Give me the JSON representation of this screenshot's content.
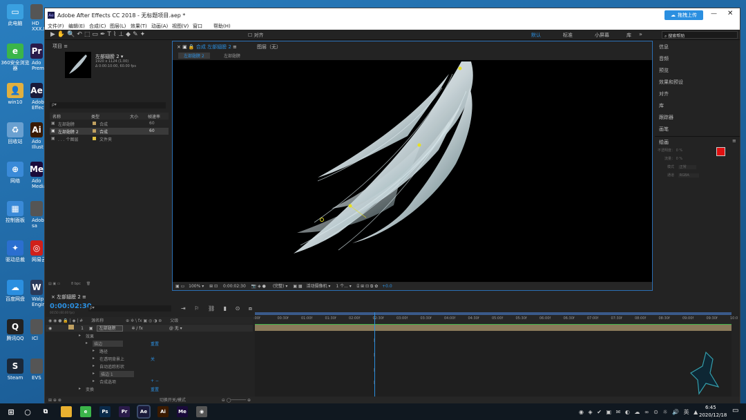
{
  "desktop": {
    "icons": [
      {
        "label": "此电脑",
        "glyph": "▭",
        "color": "#3aa0e0"
      },
      {
        "label": "360安全浏览器",
        "glyph": "e",
        "color": "#3bb54a"
      },
      {
        "label": "win10",
        "glyph": "👤",
        "color": "#e0b040"
      },
      {
        "label": "回收站",
        "glyph": "♻",
        "color": "#6aa0d0"
      },
      {
        "label": "网络",
        "glyph": "⊕",
        "color": "#3a8ad8"
      },
      {
        "label": "控制面板",
        "glyph": "▦",
        "color": "#3a8ad8"
      },
      {
        "label": "驱动总裁",
        "glyph": "✦",
        "color": "#2b6fd0"
      },
      {
        "label": "百度网盘",
        "glyph": "☁",
        "color": "#2b8fe0"
      },
      {
        "label": "腾讯QQ",
        "glyph": "Q",
        "color": "#222"
      },
      {
        "label": "Steam",
        "glyph": "S",
        "color": "#1b2838"
      }
    ],
    "icons2": [
      {
        "label": "HD\nXXX.E",
        "glyph": "",
        "color": "#555"
      },
      {
        "label": "Ado\nPremi",
        "glyph": "Pr",
        "color": "#2a1b4a"
      },
      {
        "label": "Adobe\nEffects",
        "glyph": "Ae",
        "color": "#1a1a3a"
      },
      {
        "label": "Ado\nIllust",
        "glyph": "Ai",
        "color": "#3a1a00"
      },
      {
        "label": "Ado\nMedia",
        "glyph": "Me",
        "color": "#1a0a3a"
      },
      {
        "label": "Adobe\nsa",
        "glyph": "",
        "color": "#555"
      },
      {
        "label": "网易云",
        "glyph": "◎",
        "color": "#d0201a"
      },
      {
        "label": "Walp\nEngin",
        "glyph": "W",
        "color": "#2a3a5a"
      },
      {
        "label": "ICl",
        "glyph": "",
        "color": "#555"
      },
      {
        "label": "EVS",
        "glyph": "",
        "color": "#555"
      }
    ]
  },
  "window": {
    "title": "Adobe After Effects CC 2018 - 无标题项目.aep *",
    "app_badge": "Ae",
    "upload_label": "拖拽上传",
    "menu": [
      "文件(F)",
      "编辑(E)",
      "合成(C)",
      "图层(L)",
      "效果(T)",
      "动画(A)",
      "视图(V)",
      "窗口",
      "帮助(H)"
    ],
    "toolbar_align_label": "对齐",
    "workspaces": [
      "默认",
      "标准",
      "小屏幕",
      "库"
    ],
    "search_placeholder": "搜索帮助"
  },
  "project": {
    "tab_label": "项目",
    "comp_name": "左部翅膀 2 ▾",
    "comp_info1": "1920 x 1124 (1.00)",
    "comp_info2": "Δ 0:00:10:00, 60.00 fps",
    "search_placeholder": "ρ▾",
    "columns": [
      "名称",
      "类型",
      "大小",
      "帧速率"
    ],
    "items": [
      {
        "name": "左部翅膀",
        "type": "合成",
        "size": "",
        "fps": "60",
        "color": "#c0a060"
      },
      {
        "name": "左部翅膀 2",
        "type": "合成",
        "size": "",
        "fps": "60",
        "color": "#c0a060"
      },
      {
        "name": ". . . 个图层",
        "type": "文件夹",
        "size": "",
        "fps": "",
        "color": "#e0c040"
      }
    ],
    "bpc": "8 bpc"
  },
  "composition": {
    "tab_label": "合成 左部翅膀 2",
    "layer_tab": "图层（无）",
    "subtab_active": "左部翅膀 2",
    "subtab_other": "左部翅膀",
    "zoom": "100%",
    "time": "0:00:02:30",
    "quality": "(完整)",
    "camera": "活动摄像机",
    "views": "1 个...",
    "exposure": "+0.0"
  },
  "right_panels": [
    "信息",
    "音频",
    "预览",
    "效果和预设",
    "对齐",
    "库",
    "跟踪器",
    "画笔"
  ],
  "paint": {
    "title": "绘画",
    "opacity_label": "不透明度：",
    "opacity_value": "0 %",
    "flow_label": "流量：",
    "flow_value": "0 %",
    "mode_label": "模式",
    "mode_value": "正常",
    "channel_label": "通道",
    "channel_value": "RGBA",
    "fg_color": "#e01010",
    "bg_color": "#ffffff"
  },
  "timeline": {
    "tab_label": "左部翅膀 2",
    "timecode": "0:00:02:30",
    "timecode_sub": "00150 (60.00 fps)",
    "search_placeholder": "ρ▾",
    "col_layer_name": "源名称",
    "col_parent": "父级",
    "ruler": [
      ":00f",
      "00:30f",
      "01:00f",
      "01:30f",
      "02:00f",
      "02:30f",
      "03:00f",
      "03:30f",
      "04:00f",
      "04:30f",
      "05:00f",
      "05:30f",
      "06:00f",
      "06:30f",
      "07:00f",
      "07:30f",
      "08:00f",
      "08:30f",
      "09:00f",
      "09:30f",
      "10:0"
    ],
    "current_time_fraction": 0.25,
    "layer": {
      "index": "1",
      "name": "左部翅膀",
      "parent": "无"
    },
    "rows": [
      {
        "indent": 1,
        "label": "效果",
        "value": ""
      },
      {
        "indent": 2,
        "label": "描边",
        "value": "重置"
      },
      {
        "indent": 3,
        "label": "路径",
        "value": ""
      },
      {
        "indent": 3,
        "label": "在透明背景上",
        "value": "关"
      },
      {
        "indent": 3,
        "label": "自动追踪形状",
        "value": ""
      },
      {
        "indent": 3,
        "label": "描边 1",
        "value": ""
      },
      {
        "indent": 3,
        "label": "合成选项",
        "value": "+ −"
      },
      {
        "indent": 1,
        "label": "变换",
        "value": "重置"
      }
    ],
    "footer_toggle": "切换开关/模式"
  },
  "taskbar": {
    "clock_time": "6:45",
    "clock_date": "2020/12/18",
    "ime": "英",
    "apps": [
      {
        "name": "file-explorer",
        "label": "",
        "color": "#e8b030"
      },
      {
        "name": "360",
        "label": "e",
        "color": "#3bb54a"
      },
      {
        "name": "photoshop",
        "label": "Ps",
        "color": "#0a2a4a"
      },
      {
        "name": "premiere",
        "label": "Pr",
        "color": "#2a1b4a"
      },
      {
        "name": "after-effects",
        "label": "Ae",
        "color": "#1a1a3a"
      },
      {
        "name": "illustrator",
        "label": "Ai",
        "color": "#3a1a00"
      },
      {
        "name": "media-encoder",
        "label": "Me",
        "color": "#1a0a3a"
      },
      {
        "name": "app",
        "label": "◉",
        "color": "#555"
      }
    ]
  }
}
